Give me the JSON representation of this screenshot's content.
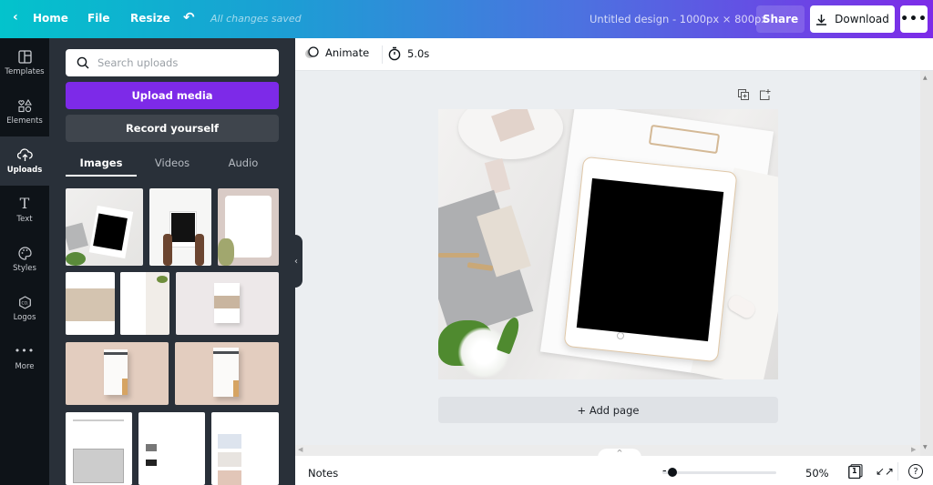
{
  "topbar": {
    "back_icon": "chevron-left-icon",
    "home": "Home",
    "file": "File",
    "resize": "Resize",
    "undo_icon": "undo-icon",
    "save_status": "All changes saved",
    "design_title": "Untitled design - 1000px × 800px",
    "share": "Share",
    "download": "Download",
    "more": "•••"
  },
  "rail": {
    "items": [
      {
        "label": "Templates",
        "icon": "templates-icon"
      },
      {
        "label": "Elements",
        "icon": "elements-icon"
      },
      {
        "label": "Uploads",
        "icon": "upload-cloud-icon",
        "active": true
      },
      {
        "label": "Text",
        "icon": "text-icon"
      },
      {
        "label": "Styles",
        "icon": "palette-icon"
      },
      {
        "label": "Logos",
        "icon": "logo-icon"
      },
      {
        "label": "More",
        "icon": "more-dots-icon"
      }
    ]
  },
  "panel": {
    "search_placeholder": "Search uploads",
    "upload_media": "Upload media",
    "record_yourself": "Record yourself",
    "tabs": [
      "Images",
      "Videos",
      "Audio"
    ],
    "active_tab": "Images",
    "thumbnails": [
      "flat-lay-tablet-clipboard",
      "hands-holding-tablet",
      "thank-you-card",
      "first-page-guide",
      "checklist-page",
      "book-mockup-pink",
      "envelope-printing-guide-1",
      "envelope-printing-guide-2",
      "document-page-1",
      "document-page-2",
      "document-page-3"
    ]
  },
  "context_bar": {
    "animate": "Animate",
    "duration": "5.0s"
  },
  "canvas": {
    "add_page": "+ Add page",
    "duplicate_icon": "duplicate-page-icon",
    "add_icon": "add-page-icon"
  },
  "footer": {
    "notes": "Notes",
    "zoom": "50%",
    "zoom_fraction": 0.1,
    "page_count": "1",
    "help": "?"
  }
}
